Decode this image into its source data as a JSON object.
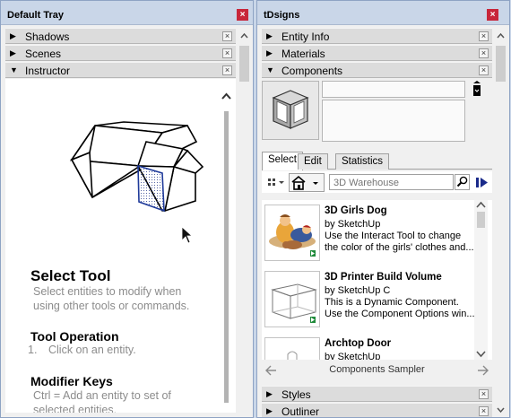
{
  "left_tray": {
    "title": "Default Tray",
    "panels": [
      {
        "label": "Shadows",
        "expanded": false
      },
      {
        "label": "Scenes",
        "expanded": false
      },
      {
        "label": "Instructor",
        "expanded": true
      }
    ],
    "instructor": {
      "title": "Select Tool",
      "description": [
        "Select entities to modify when",
        "using other tools or commands."
      ],
      "op_heading": "Tool Operation",
      "op_step": "Click on an entity.",
      "op_num": "1.",
      "mod_heading": "Modifier Keys",
      "mod_text": [
        "Ctrl = Add an entity to set of",
        "selected entities."
      ]
    }
  },
  "right_tray": {
    "title": "tDsigns",
    "panels": [
      {
        "label": "Entity Info",
        "expanded": false
      },
      {
        "label": "Materials",
        "expanded": false
      },
      {
        "label": "Components",
        "expanded": true
      }
    ],
    "bottom_panels": [
      {
        "label": "Styles",
        "expanded": false
      },
      {
        "label": "Outliner",
        "expanded": false
      }
    ],
    "components": {
      "tabs": [
        "Select",
        "Edit",
        "Statistics"
      ],
      "active_tab": "Select",
      "search_placeholder": "3D Warehouse",
      "items": [
        {
          "name": "3D Girls Dog",
          "by": "by SketchUp",
          "desc": [
            "Use the Interact Tool to change",
            "the color of the girls' clothes and..."
          ]
        },
        {
          "name": "3D Printer Build Volume",
          "by": "by SketchUp C",
          "desc": [
            "This is a Dynamic Component.",
            "Use the Component Options win..."
          ]
        },
        {
          "name": "Archtop Door",
          "by": "by SketchUp",
          "desc": []
        }
      ],
      "collection": "Components Sampler"
    }
  },
  "colors": {
    "close_red": "#c8263a",
    "tray_title_bg": "#c9d6e8",
    "panel_bg": "#dcdcdc"
  }
}
